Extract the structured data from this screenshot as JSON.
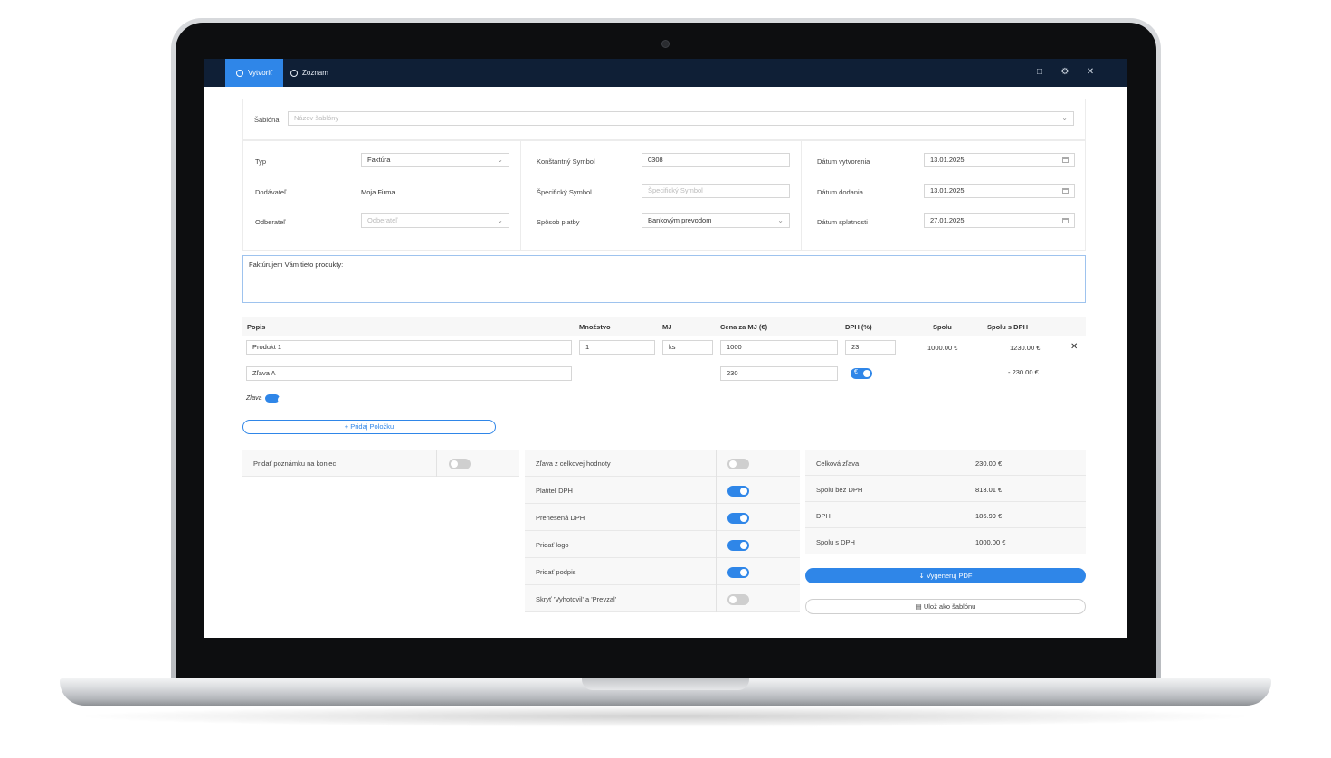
{
  "topbar": {
    "tab_create": "Vytvoriť",
    "tab_list": "Zoznam",
    "icon_chat": "chat-icon",
    "icon_settings": "gear-icon",
    "icon_close": "close-icon"
  },
  "template": {
    "label": "Šablóna",
    "placeholder": "Názov šablóny"
  },
  "col1": {
    "type_label": "Typ",
    "type_value": "Faktúra",
    "supplier_label": "Dodávateľ",
    "supplier_value": "Moja Firma",
    "customer_label": "Odberateľ",
    "customer_placeholder": "Odberateľ"
  },
  "col2": {
    "const_label": "Konštantný Symbol",
    "const_value": "0308",
    "spec_label": "Špecifický Symbol",
    "spec_placeholder": "Špecifický Symbol",
    "pay_label": "Spôsob platby",
    "pay_value": "Bankovým prevodom"
  },
  "col3": {
    "created_label": "Dátum vytvorenia",
    "created_value": "13.01.2025",
    "delivery_label": "Dátum dodania",
    "delivery_value": "13.01.2025",
    "due_label": "Dátum splatnosti",
    "due_value": "27.01.2025"
  },
  "intro_text": "Faktúrujem Vám tieto produkty:",
  "table": {
    "headers": [
      "Popis",
      "Množstvo",
      "MJ",
      "Cena za MJ (€)",
      "DPH (%)",
      "Spolu",
      "Spolu s DPH"
    ],
    "row1": {
      "desc": "Produkt 1",
      "qty": "1",
      "unit": "ks",
      "price": "1000",
      "vat": "23",
      "total": "1000.00 €",
      "total_vat": "1230.00 €"
    },
    "row2": {
      "desc": "Zľava A",
      "price": "230",
      "toggle_symbol": "€",
      "total_vat": "- 230.00 €"
    },
    "discount_toggle_label": "Zľava",
    "add_item": "Pridaj Položku"
  },
  "note": {
    "label": "Pridať poznámku na koniec"
  },
  "options": [
    {
      "label": "Zľava z celkovej hodnoty",
      "on": false
    },
    {
      "label": "Platiteľ DPH",
      "on": true
    },
    {
      "label": "Prenesená DPH",
      "on": true
    },
    {
      "label": "Pridať logo",
      "on": true
    },
    {
      "label": "Pridať podpis",
      "on": true
    },
    {
      "label": "Skryť 'Vyhotovil' a 'Prevzal'",
      "on": false
    }
  ],
  "summary": [
    {
      "label": "Celková zľava",
      "value": "230.00 €"
    },
    {
      "label": "Spolu bez DPH",
      "value": "813.01 €"
    },
    {
      "label": "DPH",
      "value": "186.99 €"
    },
    {
      "label": "Spolu s DPH",
      "value": "1000.00 €"
    }
  ],
  "buttons": {
    "generate_pdf": "Vygeneruj PDF",
    "save_template": "Ulož ako šablónu"
  }
}
